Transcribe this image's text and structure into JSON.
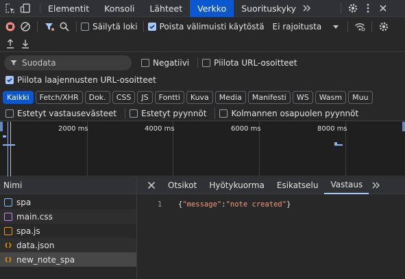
{
  "tabs": [
    "Elementit",
    "Konsoli",
    "Lähteet",
    "Verkko",
    "Suorituskyky"
  ],
  "active_tab": "Verkko",
  "toolbar": {
    "preserve_log": "Säilytä loki",
    "disable_cache": "Poista välimuisti käytöstä",
    "throttling": "Ei rajoitusta"
  },
  "filter": {
    "placeholder": "Suodata",
    "invert": "Negatiivi",
    "hide_data_urls": "Piilota URL-osoitteet",
    "hide_extension_urls": "Piilota laajennusten URL-osoitteet"
  },
  "types": [
    "Kaikki",
    "Fetch/XHR",
    "Dok.",
    "CSS",
    "JS",
    "Fontti",
    "Kuva",
    "Media",
    "Manifesti",
    "WS",
    "Wasm",
    "Muu"
  ],
  "more_filters": {
    "blocked_cookies": "Estetyt vastausevästeet",
    "blocked_requests": "Estetyt pyynnöt",
    "third_party": "Kolmannen osapuolen pyynnöt"
  },
  "overview": {
    "ticks": [
      "2000 ms",
      "4000 ms",
      "6000 ms",
      "8000 ms"
    ]
  },
  "requests": {
    "header": "Nimi",
    "items": [
      {
        "name": "spa",
        "icon": "document-icon",
        "color": "#8ab4f8"
      },
      {
        "name": "main.css",
        "icon": "stylesheet-icon",
        "color": "#c58af9"
      },
      {
        "name": "spa.js",
        "icon": "script-icon",
        "color": "#f29900"
      },
      {
        "name": "data.json",
        "icon": "fetch-icon",
        "color": "#f29900"
      },
      {
        "name": "new_note_spa",
        "icon": "fetch-icon",
        "color": "#f29900"
      }
    ],
    "selected": "new_note_spa"
  },
  "detail": {
    "tabs": [
      "Otsikot",
      "Hyötykuorma",
      "Esikatselu",
      "Vastaus"
    ],
    "active": "Vastaus",
    "line_number": "1",
    "body": "{\"message\":\"note created\"}"
  }
}
